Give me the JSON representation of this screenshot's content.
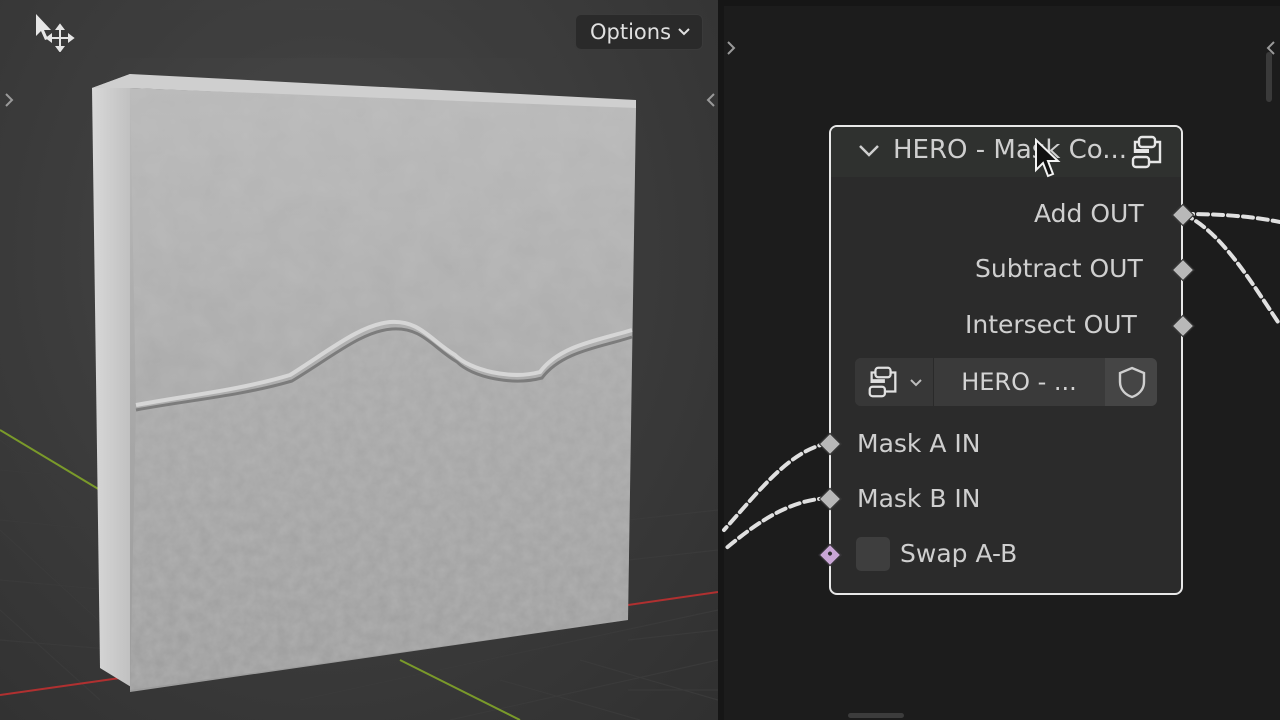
{
  "viewport": {
    "options_label": "Options",
    "tool_icon": "select-move-icon",
    "left_arrow_icon": "chevron-right-icon",
    "right_arrow_icon": "chevron-left-icon"
  },
  "node_editor": {
    "node": {
      "title": "HERO - Mask Co...",
      "outputs": [
        {
          "label": "Add OUT"
        },
        {
          "label": "Subtract OUT"
        },
        {
          "label": "Intersect OUT"
        }
      ],
      "group": {
        "name": "HERO - ...",
        "type_icon": "node-tree-icon",
        "fake_user_icon": "shield-icon"
      },
      "inputs": [
        {
          "label": "Mask A IN"
        },
        {
          "label": "Mask B IN"
        },
        {
          "label": "Swap A-B"
        }
      ]
    }
  },
  "colors": {
    "node_border": "#e8e8e8",
    "socket_gray": "#b8b8b8",
    "socket_bool": "#c9a6d6",
    "grid_red": "#b03030",
    "grid_green": "#7a9a2a"
  }
}
